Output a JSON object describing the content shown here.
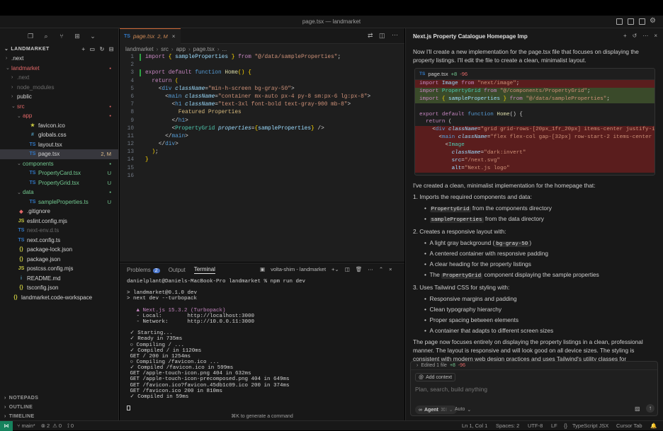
{
  "window": {
    "title": "page.tsx — landmarket"
  },
  "explorer": {
    "header": "LANDMARKET",
    "items": [
      {
        "label": ".next",
        "status": "",
        "icon": "",
        "cls": "txt"
      },
      {
        "label": "landmarket",
        "status": "•",
        "icon": "",
        "cls": "red"
      },
      {
        "label": ".next",
        "status": "",
        "icon": "",
        "cls": "dim"
      },
      {
        "label": "node_modules",
        "status": "",
        "icon": "",
        "cls": "dim"
      },
      {
        "label": "public",
        "status": "",
        "icon": "",
        "cls": "txt"
      },
      {
        "label": "src",
        "status": "•",
        "icon": "",
        "cls": "red"
      },
      {
        "label": "app",
        "status": "•",
        "icon": "",
        "cls": "red"
      },
      {
        "label": "favicon.ico",
        "status": "",
        "icon": "★",
        "cls": "txt"
      },
      {
        "label": "globals.css",
        "status": "",
        "icon": "#",
        "cls": "txt"
      },
      {
        "label": "layout.tsx",
        "status": "",
        "icon": "TS",
        "cls": "txt"
      },
      {
        "label": "page.tsx",
        "status": "2, M",
        "icon": "TS",
        "cls": "txt"
      },
      {
        "label": "components",
        "status": "•",
        "icon": "",
        "cls": "green"
      },
      {
        "label": "PropertyCard.tsx",
        "status": "U",
        "icon": "TS",
        "cls": "green"
      },
      {
        "label": "PropertyGrid.tsx",
        "status": "U",
        "icon": "TS",
        "cls": "green"
      },
      {
        "label": "data",
        "status": "•",
        "icon": "",
        "cls": "green"
      },
      {
        "label": "sampleProperties.ts",
        "status": "U",
        "icon": "TS",
        "cls": "green"
      },
      {
        "label": ".gitignore",
        "status": "",
        "icon": "◆",
        "cls": "txt"
      },
      {
        "label": "eslint.config.mjs",
        "status": "",
        "icon": "JS",
        "cls": "txt"
      },
      {
        "label": "next-env.d.ts",
        "status": "",
        "icon": "TS",
        "cls": "dim"
      },
      {
        "label": "next.config.ts",
        "status": "",
        "icon": "TS",
        "cls": "txt"
      },
      {
        "label": "package-lock.json",
        "status": "",
        "icon": "{}",
        "cls": "txt"
      },
      {
        "label": "package.json",
        "status": "",
        "icon": "{}",
        "cls": "txt"
      },
      {
        "label": "postcss.config.mjs",
        "status": "",
        "icon": "JS",
        "cls": "txt"
      },
      {
        "label": "README.md",
        "status": "",
        "icon": "i",
        "cls": "txt"
      },
      {
        "label": "tsconfig.json",
        "status": "",
        "icon": "{}",
        "cls": "txt"
      },
      {
        "label": "landmarket.code-workspace",
        "status": "",
        "icon": "{}",
        "cls": "txt"
      }
    ],
    "sections": [
      "NOTEPADS",
      "OUTLINE",
      "TIMELINE"
    ]
  },
  "editor": {
    "tab_label": "page.tsx",
    "tab_status": "2, M",
    "crumbs": [
      "landmarket",
      "src",
      "app",
      "page.tsx",
      "..."
    ],
    "lines": [
      {
        "n": "1",
        "t": ""
      },
      {
        "n": "2",
        "t": ""
      },
      {
        "n": "3",
        "t": ""
      },
      {
        "n": "4",
        "t": ""
      },
      {
        "n": "5",
        "t": ""
      },
      {
        "n": "6",
        "t": ""
      },
      {
        "n": "7",
        "t": ""
      },
      {
        "n": "8",
        "t": ""
      },
      {
        "n": "9",
        "t": ""
      },
      {
        "n": "10",
        "t": ""
      },
      {
        "n": "11",
        "t": ""
      },
      {
        "n": "12",
        "t": ""
      },
      {
        "n": "13",
        "t": ""
      },
      {
        "n": "14",
        "t": ""
      },
      {
        "n": "15",
        "t": ""
      },
      {
        "n": "16",
        "t": ""
      }
    ]
  },
  "panel": {
    "tabs": [
      "Problems",
      "Output",
      "Terminal"
    ],
    "problems_count": "2",
    "terminal_name": "volta-shim - landmarket",
    "hint": "⌘K to generate a command",
    "lines": [
      "danielplant@Daniels-MacBook-Pro landmarket % npm run dev",
      "",
      "> landmarket@0.1.0 dev",
      "> next dev --turbopack",
      "",
      "   ▲ Next.js 15.3.2 (Turbopack)",
      "   - Local:        http://localhost:3000",
      "   - Network:      http://10.0.0.11:3000",
      "",
      " ✓ Starting...",
      " ✓ Ready in 735ms",
      " ○ Compiling / ...",
      " ✓ Compiled / in 1120ms",
      " GET / 200 in 1254ms",
      " ○ Compiling /favicon.ico ...",
      " ✓ Compiled /favicon.ico in 599ms",
      " GET /apple-touch-icon.png 404 in 632ms",
      " GET /apple-touch-icon-precomposed.png 404 in 649ms",
      " GET /favicon.ico?favicon.45db1c09.ico 200 in 374ms",
      " GET /favicon.ico 200 in 810ms",
      " ✓ Compiled in 59ms",
      ""
    ]
  },
  "chat": {
    "tab_title": "Next.js Property Catalogue Homepage Imp",
    "intro": "Now I'll create a new implementation for the page.tsx file that focuses on displaying the property listings. I'll edit the file to create a clean, minimalist layout.",
    "diff_file": "page.tsx",
    "diff_add": "+8",
    "diff_del": "-96",
    "summary": "I've created a clean, minimalist implementation for the homepage that:",
    "s1": "1. Imports the required components and data:",
    "s1a": "from the components directory",
    "s1a_code": "PropertyGrid",
    "s1b": "from the data directory",
    "s1b_code": "sampleProperties",
    "s2": "2. Creates a responsive layout with:",
    "s2a": "A light gray background (",
    "s2a_code": "bg-gray-50",
    "s2a_end": ")",
    "s2b": "A centered container with responsive padding",
    "s2c": "A clear heading for the property listings",
    "s2d_pre": "The",
    "s2d_code": "PropertyGrid",
    "s2d": "component displaying the sample properties",
    "s3": "3. Uses Tailwind CSS for styling with:",
    "s3a": "Responsive margins and padding",
    "s3b": "Clean typography hierarchy",
    "s3c": "Proper spacing between elements",
    "s3d": "A container that adapts to different screen sizes",
    "closing": "The page now focuses entirely on displaying the property listings in a clean, professional manner. The layout is responsive and will look good on all device sizes. The styling is consistent with modern web design practices and uses Tailwind's utility classes for",
    "edited": "Edited 1 file",
    "edited_add": "+8",
    "edited_del": "-96",
    "add_context": "Add context",
    "placeholder": "Plan, search, build anything",
    "mode": "Agent",
    "mode_key": "⌘I",
    "model": "Auto"
  },
  "status": {
    "branch": "main*",
    "errors": "2",
    "warnings": "0",
    "ports": "0",
    "position": "Ln 1, Col 1",
    "spaces": "Spaces: 2",
    "encoding": "UTF-8",
    "eol": "LF",
    "lang": "TypeScript JSX",
    "tab": "Cursor Tab"
  }
}
